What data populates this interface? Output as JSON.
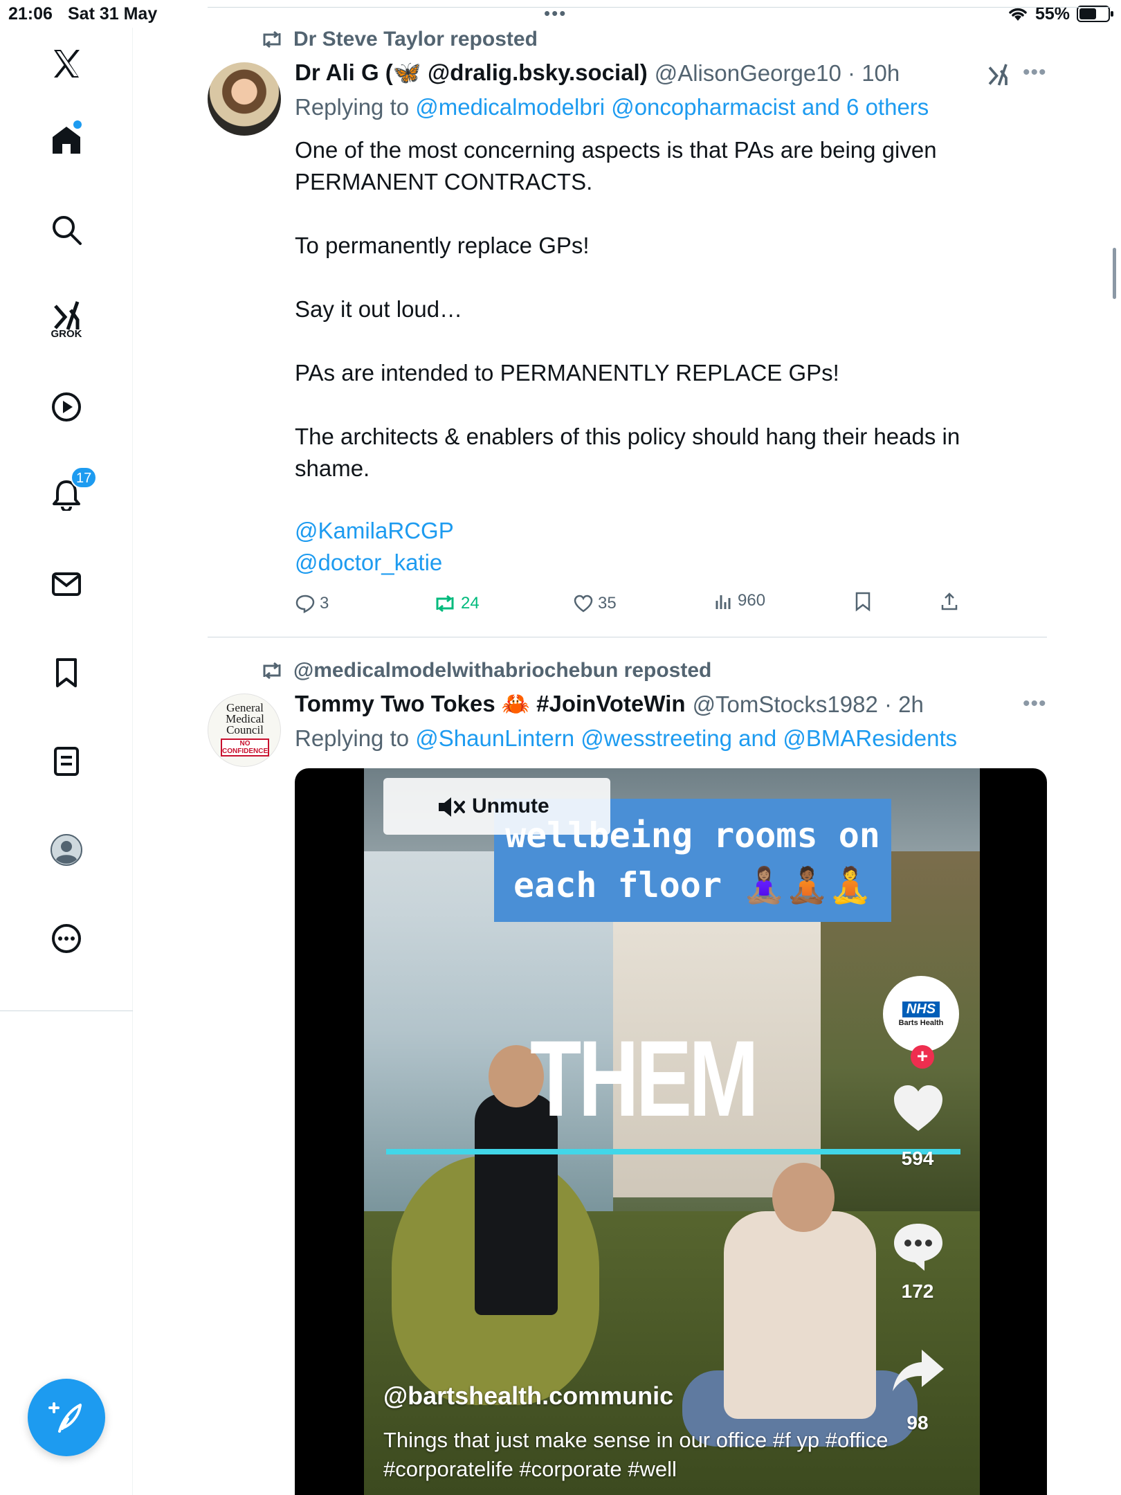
{
  "status_bar": {
    "time": "21:06",
    "date": "Sat 31 May",
    "battery": "55%"
  },
  "sidebar": {
    "items": [
      {
        "name": "x-logo-icon"
      },
      {
        "name": "home-icon"
      },
      {
        "name": "search-icon"
      },
      {
        "name": "grok-icon",
        "label": "GROK"
      },
      {
        "name": "video-icon"
      },
      {
        "name": "notifications-icon",
        "badge": "17"
      },
      {
        "name": "messages-icon"
      },
      {
        "name": "bookmarks-icon"
      },
      {
        "name": "lists-icon"
      },
      {
        "name": "profile-icon"
      },
      {
        "name": "more-icon"
      }
    ],
    "compose": "compose-icon"
  },
  "tweets": [
    {
      "repost_by": "Dr Steve Taylor reposted",
      "author": "Dr Ali G (🦋 @dralig.bsky.social)",
      "handle": "@AlisonGeorge10 · 10h",
      "replying_prefix": "Replying to ",
      "replying_to": "@medicalmodelbri @oncopharmacist and 6 others",
      "lines": [
        "One of the most concerning aspects is that PAs are being given",
        "PERMANENT CONTRACTS.",
        "To permanently replace GPs!",
        "Say it out loud…",
        "PAs are intended to PERMANENTLY REPLACE GPs!",
        "The architects & enablers of this policy should hang their heads in",
        "shame."
      ],
      "mentions": [
        "@KamilaRCGP",
        "@doctor_katie"
      ],
      "actions": {
        "replies": "3",
        "reposts": "24",
        "likes": "35",
        "views": "960"
      }
    },
    {
      "repost_by": "@medicalmodelwithabriochebun reposted",
      "author": "Tommy Two Tokes 🦀 #JoinVoteWin",
      "handle": "@TomStocks1982 · 2h",
      "replying_prefix": "Replying to ",
      "replying_to": "@ShaunLintern @wesstreeting and @BMAResidents",
      "avatar_text": [
        "General",
        "Medical",
        "Council",
        "NO",
        "CONFIDENCE"
      ],
      "video": {
        "unmute_label": "Unmute",
        "caption_line1": "wellbeing rooms on",
        "caption_line2": "each floor 🧘🏽‍♀️🧘🏾🧘",
        "big_text": "THEM",
        "nhs": "NHS",
        "nhs_sub": "Barts Health",
        "likes": "594",
        "comments": "172",
        "shares": "98",
        "overlay_handle": "@bartshealth.communic",
        "overlay_caption": "Things that just make sense in our office  #f yp #office #corporatelife #corporate #well"
      }
    }
  ]
}
